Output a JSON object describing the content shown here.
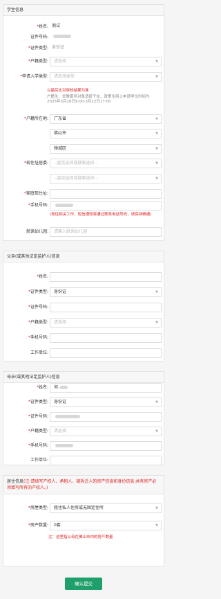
{
  "student": {
    "header": "学生信息",
    "name_label": "姓名:",
    "name_value": "测试",
    "id_no_label": "证件号码:",
    "id_type_label": "证件类型:",
    "id_type_value": "身份证",
    "hukou_type_label": "户籍类型:",
    "hukou_type_placeholder": "请选择",
    "apply_type_label": "申请入学类型:",
    "apply_type_placeholder": "请选择类型",
    "notice_red": "以最后比对审核结果为准",
    "notice_gray": "户籍生、优教服务对象适龄子女、政策生网上申请学位时间为2025年3月16日9:00-3月22日17:00",
    "hukou_loc_label": "户籍所在地:",
    "province": "广东省",
    "city": "佛山市",
    "district": "禅城区",
    "residence_label": "现住址居委:",
    "residence_placeholder_1": "--直接选择或搜索选择--",
    "residence_placeholder_2": "--直接选择或搜索选择--",
    "home_address_label": "家庭现住址:",
    "phone_label": "手机号码:",
    "phone_note": "(现住相关工作、短信通知将通过联系电话号码，请保持畅通)",
    "kindergarten_label": "就读幼儿园:",
    "kindergarten_placeholder": "请输入就读幼儿园"
  },
  "father": {
    "header": "父亲(或其他法定监护人)信息",
    "name_label": "姓名:",
    "id_type_label": "证件类型:",
    "id_type_value": "身份证",
    "id_no_label": "证件号码:",
    "hukou_type_label": "户籍类型:",
    "hukou_type_placeholder": "请选择",
    "phone_label": "手机号码:",
    "work_label": "工作单位:"
  },
  "mother": {
    "header": "母亲(或其他法定监护人)信息",
    "name_label": "姓名:",
    "name_value": "何",
    "id_type_label": "证件类型:",
    "id_type_value": "身份证",
    "id_no_label": "证件号码:",
    "hukou_type_label": "户籍类型:",
    "hukou_type_placeholder": "请选择",
    "phone_label": "手机号码:",
    "work_label": "工作单位:"
  },
  "housing": {
    "header_text": "居住信息",
    "header_note": "(注:请填写产权人、承租人、被拆迁人的房产信息和身份信息,共有房产必须填写所有的产权人。)",
    "house_type_label": "房屋类型:",
    "house_type_value": "租住私人住房或无固定住所",
    "house_count_label": "房产数量:",
    "house_count_value": "0套",
    "note": "注：这里指父母在佛山市内的房产数量"
  },
  "submit_label": "确认提交"
}
